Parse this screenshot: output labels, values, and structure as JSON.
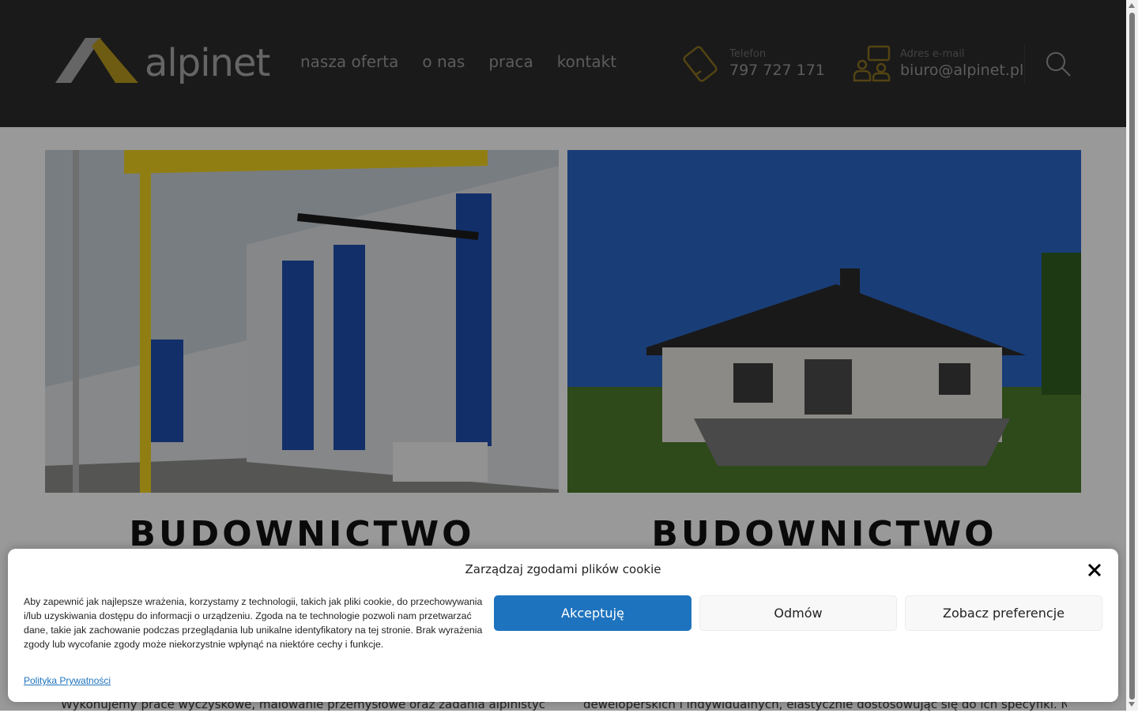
{
  "header": {
    "logo_text": "alpinet",
    "nav": [
      "nasza oferta",
      "o nas",
      "praca",
      "kontakt"
    ],
    "phone": {
      "label": "Telefon",
      "value": "797 727 171"
    },
    "email": {
      "label": "Adres e-mail",
      "value": "biuro@alpinet.pl"
    }
  },
  "sections": [
    {
      "heading": "BUDOWNICTWO",
      "text": "Wykonujemy prace wyczyskowe, malowanie przemysłowe oraz zadania alpinistyczne w"
    },
    {
      "heading": "BUDOWNICTWO",
      "text": "deweloperskich i indywidualnych, elastycznie dostosowując się do ich specyfiki. Nasze"
    }
  ],
  "cookie": {
    "title": "Zarządzaj zgodami plików cookie",
    "text": "Aby zapewnić jak najlepsze wrażenia, korzystamy z technologii, takich jak pliki cookie, do przechowywania i/lub uzyskiwania dostępu do informacji o urządzeniu. Zgoda na te technologie pozwoli nam przetwarzać dane, takie jak zachowanie podczas przeglądania lub unikalne identyfikatory na tej stronie. Brak wyrażenia zgody lub wycofanie zgody może niekorzystnie wpłynąć na niektóre cechy i funkcje.",
    "accept": "Akceptuję",
    "deny": "Odmów",
    "prefs": "Zobacz preferencje",
    "privacy_link": "Polityka Prywatności"
  },
  "colors": {
    "accent": "#e8b41c",
    "header_bg": "#2c2c2c",
    "button_primary": "#1e73be"
  }
}
